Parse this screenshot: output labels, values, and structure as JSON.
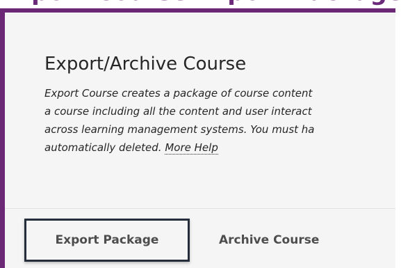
{
  "header_strip": {
    "text": "Export Course Export Package"
  },
  "page": {
    "title": "Export/Archive Course",
    "description_lines": [
      "Export Course creates a package of course content",
      "a course including all the content and user interact",
      "across learning management systems. You must ha",
      "automatically deleted."
    ],
    "more_help_link": "More Help"
  },
  "tabs": [
    {
      "label": "Export Package",
      "selected": true
    },
    {
      "label": "Archive Course",
      "selected": false
    }
  ],
  "colors": {
    "frame_border": "#6b2874",
    "panel_background": "#f5f5f5",
    "text": "#262626",
    "tab_text": "#4d4d4d",
    "selected_tab_border": "#262d3a"
  }
}
